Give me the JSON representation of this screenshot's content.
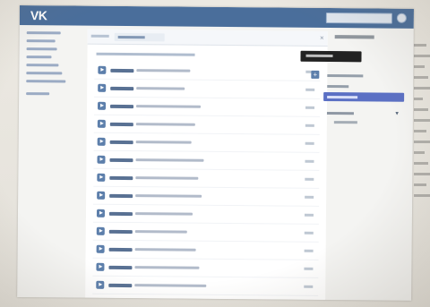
{
  "app": {
    "logo_text": "VK",
    "brand_color": "#4a6e9b",
    "accent_color": "#5b70c4"
  },
  "header": {
    "search_placeholder": "",
    "search_icon": "search-icon"
  },
  "left_menu": {
    "items": [
      {
        "label": ""
      },
      {
        "label": ""
      },
      {
        "label": ""
      },
      {
        "label": ""
      },
      {
        "label": ""
      },
      {
        "label": ""
      },
      {
        "label": ""
      },
      {
        "label": ""
      }
    ]
  },
  "content": {
    "tab_label": "",
    "close_icon": "close-icon",
    "subtitle": "",
    "tracks": [
      {
        "artist": "",
        "title": "",
        "duration": ""
      },
      {
        "artist": "",
        "title": "",
        "duration": ""
      },
      {
        "artist": "",
        "title": "",
        "duration": ""
      },
      {
        "artist": "",
        "title": "",
        "duration": ""
      },
      {
        "artist": "",
        "title": "",
        "duration": ""
      },
      {
        "artist": "",
        "title": "",
        "duration": ""
      },
      {
        "artist": "",
        "title": "",
        "duration": ""
      },
      {
        "artist": "",
        "title": "",
        "duration": ""
      },
      {
        "artist": "",
        "title": "",
        "duration": ""
      },
      {
        "artist": "",
        "title": "",
        "duration": ""
      },
      {
        "artist": "",
        "title": "",
        "duration": ""
      },
      {
        "artist": "",
        "title": "",
        "duration": ""
      },
      {
        "artist": "",
        "title": "",
        "duration": ""
      },
      {
        "artist": "",
        "title": "",
        "duration": ""
      }
    ]
  },
  "right_panel": {
    "user_name": "",
    "tooltip": "",
    "add_label": "+",
    "menu": [
      {
        "label": "",
        "active": false
      },
      {
        "label": "",
        "active": false
      },
      {
        "label": "",
        "active": true
      }
    ],
    "filter_label": "",
    "filter_sub": ""
  }
}
